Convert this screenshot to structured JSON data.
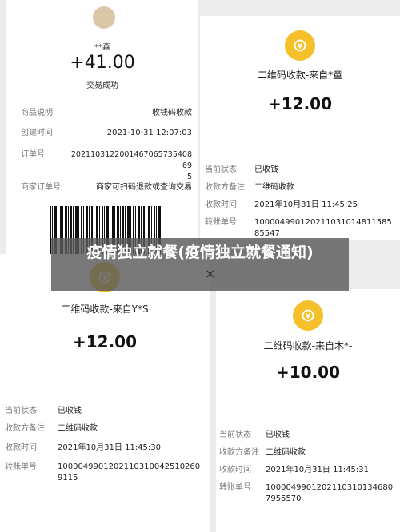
{
  "receipt": {
    "name": "**森",
    "amount": "+41.00",
    "status": "交易成功",
    "rows": [
      {
        "label": "商品说明",
        "value": "收钱码收款"
      },
      {
        "label": "创建时间",
        "value": "2021-10-31 12:07:03"
      },
      {
        "label": "订单号",
        "value": "20211031220014670657354086​9\n5"
      },
      {
        "label": "商家订单号",
        "value": "商家可扫码退款或查询交易"
      }
    ]
  },
  "card_top_right": {
    "title": "二维码收款-来自*童",
    "amount": "+12.00",
    "rows": [
      {
        "label": "当前状态",
        "value": "已收钱"
      },
      {
        "label": "收款方备注",
        "value": "二维码收款"
      },
      {
        "label": "收款时间",
        "value": "2021年10月31日 11:45:25"
      },
      {
        "label": "转账单号",
        "value": "10000499012021103101481158585547"
      }
    ]
  },
  "card_bottom_left": {
    "title": "二维码收款-来自Y*S",
    "amount": "+12.00",
    "rows": [
      {
        "label": "当前状态",
        "value": "已收钱"
      },
      {
        "label": "收款方备注",
        "value": "二维码收款"
      },
      {
        "label": "收款时间",
        "value": "2021年10月31日 11:45:30"
      },
      {
        "label": "转账单号",
        "value": "10000499012021103100425102609115"
      }
    ]
  },
  "card_bottom_right": {
    "title": "二维码收款-来自木*-",
    "amount": "+10.00",
    "rows": [
      {
        "label": "当前状态",
        "value": "已收钱"
      },
      {
        "label": "收款方备注",
        "value": "二维码收款"
      },
      {
        "label": "收款时间",
        "value": "2021年10月31日 11:45:31"
      },
      {
        "label": "转账单号",
        "value": "10000499012021103101346807955570"
      }
    ]
  },
  "overlay": {
    "text": "疫情独立就餐(疫情独立就餐通知)",
    "close": "×"
  }
}
